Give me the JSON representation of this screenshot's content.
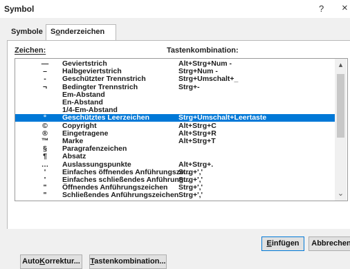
{
  "window": {
    "title": "Symbol",
    "help": "?",
    "close": "×"
  },
  "tabs": [
    {
      "label_prefix": "Symbole",
      "label_u": "",
      "label_rest": ""
    },
    {
      "label_prefix": "S",
      "label_u": "o",
      "label_rest": "nderzeichen"
    }
  ],
  "headers": {
    "chars": "Zeichen:",
    "keys": "Tastenkombination:"
  },
  "rows": [
    {
      "symbol": "—",
      "name": "Geviertstrich",
      "shortcut": "Alt+Strg+Num -"
    },
    {
      "symbol": "–",
      "name": "Halbgeviertstrich",
      "shortcut": "Strg+Num -"
    },
    {
      "symbol": "-",
      "name": "Geschützter Trennstrich",
      "shortcut": "Strg+Umschalt+_"
    },
    {
      "symbol": "¬",
      "name": "Bedingter Trennstrich",
      "shortcut": "Strg+-"
    },
    {
      "symbol": "",
      "name": "Em-Abstand",
      "shortcut": ""
    },
    {
      "symbol": "",
      "name": "En-Abstand",
      "shortcut": ""
    },
    {
      "symbol": "",
      "name": "1/4-Em-Abstand",
      "shortcut": ""
    },
    {
      "symbol": "°",
      "name": "Geschütztes Leerzeichen",
      "shortcut": "Strg+Umschalt+Leertaste",
      "selected": true
    },
    {
      "symbol": "©",
      "name": "Copyright",
      "shortcut": "Alt+Strg+C"
    },
    {
      "symbol": "®",
      "name": "Eingetragene",
      "shortcut": "Alt+Strg+R"
    },
    {
      "symbol": "™",
      "name": "Marke",
      "shortcut": "Alt+Strg+T"
    },
    {
      "symbol": "§",
      "name": "Paragrafenzeichen",
      "shortcut": ""
    },
    {
      "symbol": "¶",
      "name": "Absatz",
      "shortcut": ""
    },
    {
      "symbol": "…",
      "name": "Auslassungspunkte",
      "shortcut": "Alt+Strg+."
    },
    {
      "symbol": "'",
      "name": "Einfaches öffnendes Anführungsze...",
      "shortcut": "Strg+','"
    },
    {
      "symbol": "'",
      "name": "Einfaches schließendes Anführung...",
      "shortcut": "Strg+','"
    },
    {
      "symbol": "\"",
      "name": "Öffnendes Anführungszeichen",
      "shortcut": "Strg+','"
    },
    {
      "symbol": "\"",
      "name": "Schließendes Anführungszeichen",
      "shortcut": "Strg+','"
    }
  ],
  "scrollbar": {
    "up_icon": "▴",
    "down_icon": "⌄"
  },
  "buttons": {
    "autocorrect": {
      "prefix": "Auto",
      "u": "K",
      "rest": "orrektur..."
    },
    "shortcut": {
      "prefix": "",
      "u": "T",
      "rest": "astenkombination..."
    },
    "insert": {
      "prefix": "",
      "u": "E",
      "rest": "infügen"
    },
    "cancel": {
      "label": "Abbrechen"
    }
  }
}
